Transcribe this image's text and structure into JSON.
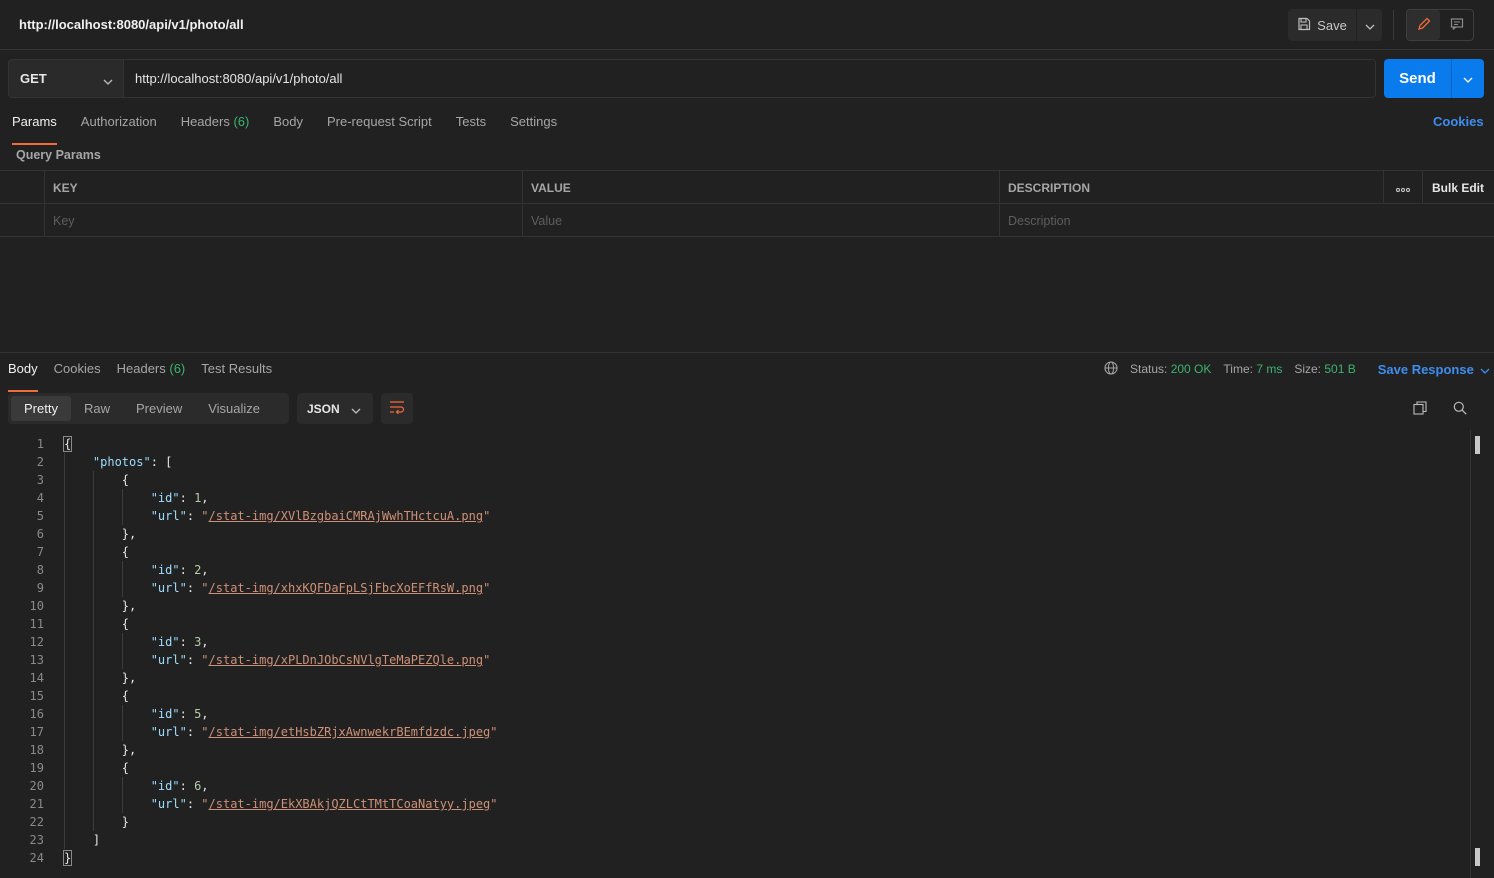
{
  "header": {
    "title": "http://localhost:8080/api/v1/photo/all",
    "save_label": "Save"
  },
  "request": {
    "method": "GET",
    "url": "http://localhost:8080/api/v1/photo/all",
    "send_label": "Send",
    "tabs": [
      {
        "label": "Params",
        "count": ""
      },
      {
        "label": "Authorization",
        "count": ""
      },
      {
        "label": "Headers",
        "count": "(6)"
      },
      {
        "label": "Body",
        "count": ""
      },
      {
        "label": "Pre-request Script",
        "count": ""
      },
      {
        "label": "Tests",
        "count": ""
      },
      {
        "label": "Settings",
        "count": ""
      }
    ],
    "cookies_label": "Cookies",
    "query_params_label": "Query Params",
    "table": {
      "headers": [
        "KEY",
        "VALUE",
        "DESCRIPTION"
      ],
      "placeholders": [
        "Key",
        "Value",
        "Description"
      ],
      "bulk_edit_label": "Bulk Edit"
    }
  },
  "response": {
    "tabs": [
      {
        "label": "Body",
        "count": ""
      },
      {
        "label": "Cookies",
        "count": ""
      },
      {
        "label": "Headers",
        "count": "(6)"
      },
      {
        "label": "Test Results",
        "count": ""
      }
    ],
    "status_label": "Status:",
    "status_value": "200 OK",
    "time_label": "Time:",
    "time_value": "7 ms",
    "size_label": "Size:",
    "size_value": "501 B",
    "save_response_label": "Save Response",
    "view_tabs": [
      "Pretty",
      "Raw",
      "Preview",
      "Visualize"
    ],
    "format": "JSON",
    "photos": [
      {
        "id": "1",
        "url": "/stat-img/XVlBzgbaiCMRAjWwhTHctcuA.png"
      },
      {
        "id": "2",
        "url": "/stat-img/xhxKQFDaFpLSjFbcXoEFfRsW.png"
      },
      {
        "id": "3",
        "url": "/stat-img/xPLDnJObCsNVlgTeMaPEZQle.png"
      },
      {
        "id": "5",
        "url": "/stat-img/etHsbZRjxAwnwekrBEmfdzdc.jpeg"
      },
      {
        "id": "6",
        "url": "/stat-img/EkXBAkjQZLCtTMtTCoaNatyy.jpeg"
      }
    ],
    "json_keys": {
      "root": "photos",
      "id": "id",
      "url": "url"
    }
  },
  "icons": {
    "save": "save-icon",
    "edit": "pencil-icon",
    "comments": "comment-icon",
    "globe": "globe-icon",
    "copy": "copy-icon",
    "search": "search-icon",
    "wrap": "wrap-lines-icon",
    "more": "more-horizontal-icon"
  },
  "colors": {
    "accent_orange": "#f26b3a",
    "primary_blue": "#097bed",
    "link_blue": "#3d8ef0",
    "status_green": "#3cb371"
  }
}
